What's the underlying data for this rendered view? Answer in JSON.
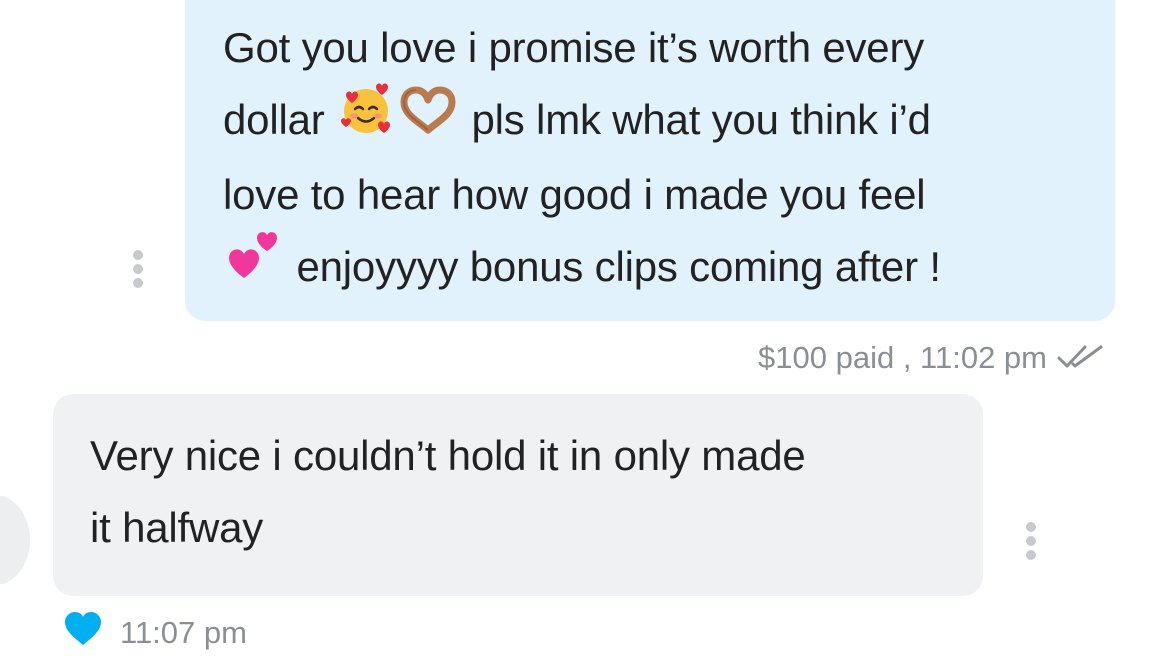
{
  "outgoing_message": {
    "line1": "Got you love i promise it’s worth every",
    "line2_before_emoji": "dollar",
    "line2_after_emoji": "pls lmk what you think i’d",
    "line3": "love to hear how good i made you feel",
    "line4_after_emoji": "enjoyyyy bonus clips coming after !",
    "emoji_icons": [
      "smiling-face-with-hearts-icon",
      "heart-hands-icon",
      "two-hearts-icon"
    ],
    "meta": "$100 paid , 11:02 pm",
    "status_icon": "double-check-icon",
    "bubble_color": "#e1f2fd"
  },
  "incoming_message": {
    "line1": "Very nice i couldn’t hold it in only made",
    "line2": "it halfway",
    "time": "11:07 pm",
    "liked_icon": "heart-icon",
    "like_color": "#00aff0",
    "bubble_color": "#f0f1f3"
  }
}
